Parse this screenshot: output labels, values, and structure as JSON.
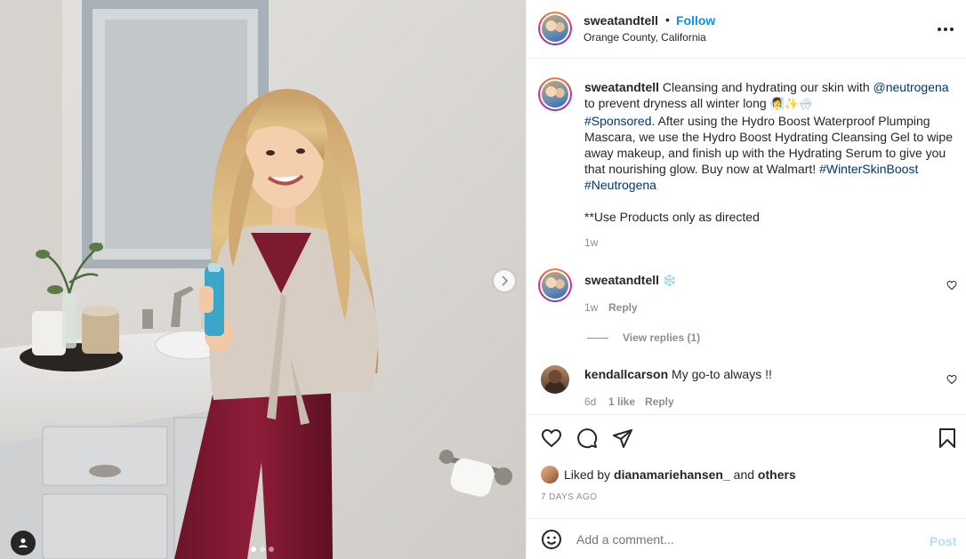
{
  "header": {
    "username": "sweatandtell",
    "separator": "•",
    "follow_label": "Follow",
    "location": "Orange County, California",
    "more_icon": "more-horizontal-icon"
  },
  "caption": {
    "username": "sweatandtell",
    "text_1": " Cleansing and hydrating our skin with ",
    "mention": "@neutrogena",
    "text_2": " to prevent dryness all winter long ",
    "emoji": "🧖‍♀️✨🌨️",
    "hashtag_sponsored": "#Sponsored",
    "text_3": ". After using the Hydro Boost Waterproof Plumping Mascara, we use the Hydro Boost Hydrating Cleansing Gel to wipe away makeup, and finish up with the Hydrating Serum to give you that nourishing glow. Buy now at Walmart! ",
    "hashtag_1": "#WinterSkinBoost",
    "hashtag_2": "#Neutrogena",
    "note": "**Use Products only as directed",
    "time": "1w"
  },
  "comments": [
    {
      "username": "sweatandtell",
      "text": "❄️",
      "time": "1w",
      "likes": "",
      "reply_label": "Reply",
      "view_replies": "View replies (1)"
    },
    {
      "username": "kendallcarson",
      "text": " My go-to always !!",
      "time": "6d",
      "likes": "1 like",
      "reply_label": "Reply"
    }
  ],
  "actions": {
    "liked_by_prefix": "Liked by ",
    "liked_by_user": "dianamariehansen_",
    "liked_by_and": " and ",
    "liked_by_others": "others",
    "date": "7 DAYS AGO"
  },
  "add_comment": {
    "placeholder": "Add a comment...",
    "post_label": "Post"
  },
  "carousel": {
    "total_slides": 3,
    "active_slide": 1
  },
  "colors": {
    "link_blue": "#0095f6",
    "hashtag_navy": "#00376b",
    "muted": "#8e8e8e",
    "post_disabled": "#b2dffc"
  }
}
